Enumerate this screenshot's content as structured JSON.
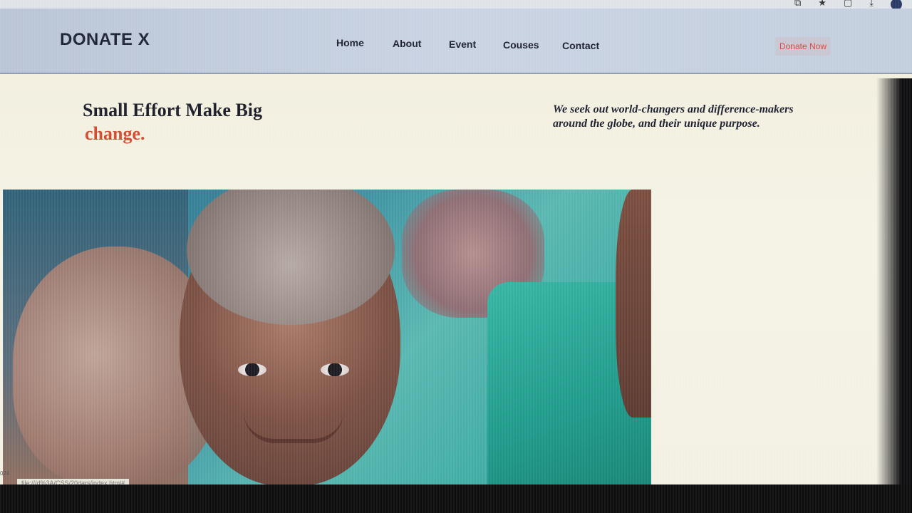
{
  "site": {
    "logo": "DONATE X",
    "nav": [
      "Home",
      "About",
      "Event",
      "Couses",
      "Contact"
    ],
    "cta": "Donate Now"
  },
  "hero": {
    "title_line1": "Small Effort Make Big",
    "title_accent": "change.",
    "description": "We seek out world-changers and difference-makers around the globe, and their unique purpose."
  },
  "status_bar": {
    "url": "file:///d%3A/CSS/20dars/index.html#"
  },
  "side_label": "024",
  "colors": {
    "accent": "#d04a2f",
    "header_bg": "#c9d3e3",
    "page_bg": "#f3f0e3",
    "cta_text": "#e0433a"
  },
  "icons": [
    "extension-icon",
    "bookmark-star-icon",
    "window-icon",
    "download-icon",
    "profile-avatar-icon"
  ]
}
